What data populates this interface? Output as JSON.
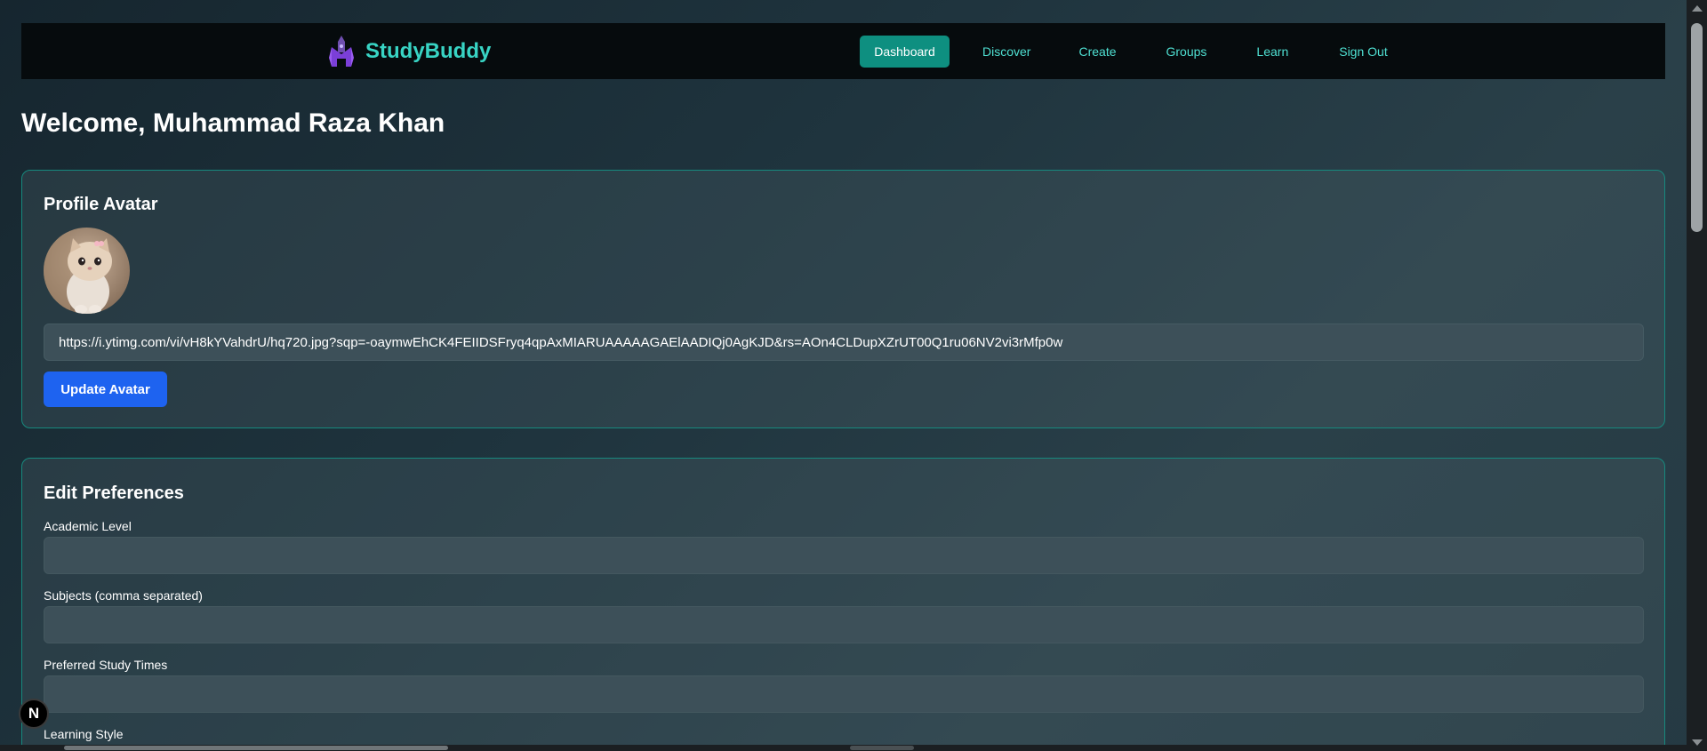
{
  "brand": {
    "name": "StudyBuddy",
    "accent_color": "#38d4c4",
    "logo_icon": "rocket-house-icon"
  },
  "nav": {
    "items": [
      {
        "label": "Dashboard",
        "active": true
      },
      {
        "label": "Discover"
      },
      {
        "label": "Create"
      },
      {
        "label": "Groups"
      },
      {
        "label": "Learn"
      },
      {
        "label": "Sign Out"
      }
    ]
  },
  "welcome": "Welcome, Muhammad Raza Khan",
  "avatar_section": {
    "title": "Profile Avatar",
    "avatar_alt": "kitten-avatar",
    "url_value": "https://i.ytimg.com/vi/vH8kYVahdrU/hq720.jpg?sqp=-oaymwEhCK4FEIIDSFryq4qpAxMIARUAAAAAGAElAADIQj0AgKJD&rs=AOn4CLDupXZrUT00Q1ru06NV2vi3rMfp0w",
    "button_label": "Update Avatar"
  },
  "preferences": {
    "title": "Edit Preferences",
    "fields": [
      {
        "label": "Academic Level",
        "value": ""
      },
      {
        "label": "Subjects (comma separated)",
        "value": ""
      },
      {
        "label": "Preferred Study Times",
        "value": ""
      },
      {
        "label": "Learning Style",
        "value": ""
      }
    ]
  },
  "dev_badge": "N",
  "colors": {
    "button_blue": "#1e63f0",
    "active_tab": "#0e8f80",
    "card_border": "#17897e"
  }
}
